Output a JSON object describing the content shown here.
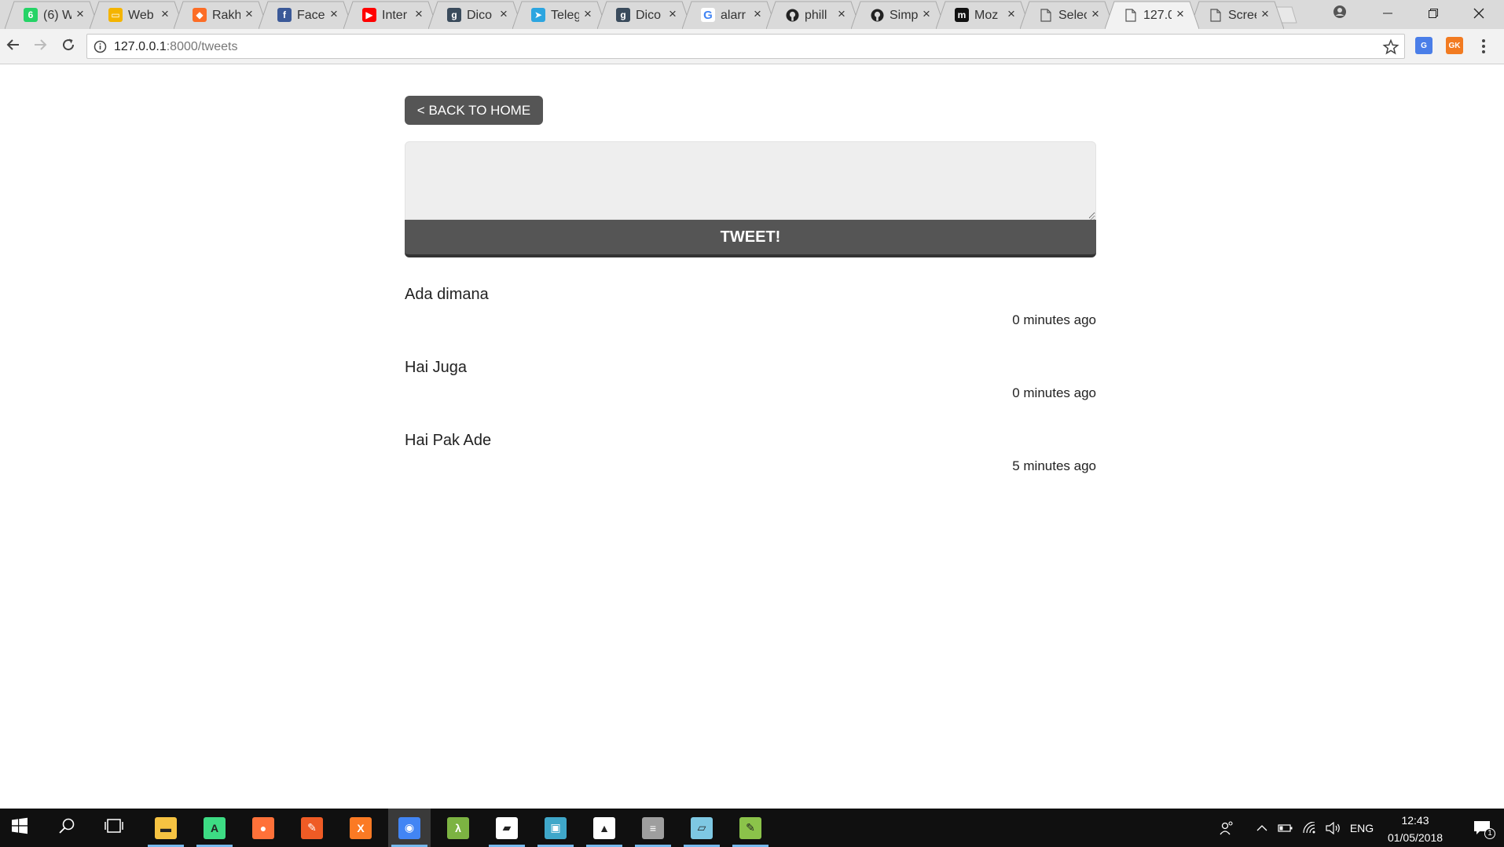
{
  "browser": {
    "tabs": [
      {
        "title": "(6) W",
        "favicon": "whatsapp-icon",
        "color": "#25d366",
        "glyph": "6"
      },
      {
        "title": "Web",
        "favicon": "slides-icon",
        "color": "#f4b400",
        "glyph": "▭"
      },
      {
        "title": "Rakh",
        "favicon": "gitlab-icon",
        "color": "#fc6d26",
        "glyph": "◆"
      },
      {
        "title": "Face",
        "favicon": "facebook-icon",
        "color": "#3b5998",
        "glyph": "f"
      },
      {
        "title": "Inter",
        "favicon": "youtube-icon",
        "color": "#ff0000",
        "glyph": "▶"
      },
      {
        "title": "Dico",
        "favicon": "goodreads-icon",
        "color": "#3a4b5c",
        "glyph": "g"
      },
      {
        "title": "Teleg",
        "favicon": "telegram-icon",
        "color": "#2ca5e0",
        "glyph": "➤"
      },
      {
        "title": "Dico",
        "favicon": "goodreads-icon",
        "color": "#3a4b5c",
        "glyph": "g"
      },
      {
        "title": "alarr",
        "favicon": "google-icon",
        "color": "#ffffff",
        "glyph": "G"
      },
      {
        "title": "phill",
        "favicon": "github-icon",
        "color": "#222222",
        "glyph": "●"
      },
      {
        "title": "Simp",
        "favicon": "github-icon",
        "color": "#222222",
        "glyph": "●"
      },
      {
        "title": "Moz",
        "favicon": "medium-icon",
        "color": "#111111",
        "glyph": "m"
      },
      {
        "title": "Selec",
        "favicon": "page-icon",
        "color": "#dadada",
        "glyph": ""
      },
      {
        "title": "127.0",
        "favicon": "page-icon",
        "color": "#f2f2f2",
        "glyph": "",
        "active": true
      },
      {
        "title": "Scree",
        "favicon": "page-icon",
        "color": "#dadada",
        "glyph": ""
      }
    ],
    "close_glyph": "×",
    "url_host": "127.0.0.1",
    "url_rest": ":8000/tweets"
  },
  "page": {
    "back_label": "< BACK TO HOME",
    "tweet_placeholder": "",
    "tweet_button": "TWEET!",
    "tweets": [
      {
        "text": "Ada dimana",
        "time": "0 minutes ago"
      },
      {
        "text": "Hai Juga",
        "time": "0 minutes ago"
      },
      {
        "text": "Hai Pak Ade",
        "time": "5 minutes ago"
      }
    ]
  },
  "taskbar": {
    "language": "ENG",
    "time": "12:43",
    "date": "01/05/2018",
    "notification_count": "1",
    "apps": [
      {
        "name": "file-explorer-icon",
        "color": "#f6c342",
        "glyph": "▬",
        "running": true
      },
      {
        "name": "android-studio-icon",
        "color": "#3ddc84",
        "glyph": "A",
        "running": true
      },
      {
        "name": "firefox-icon",
        "color": "#ff7139",
        "glyph": "●",
        "running": false
      },
      {
        "name": "postman-icon",
        "color": "#ef5b25",
        "glyph": "✎",
        "running": false
      },
      {
        "name": "xampp-icon",
        "color": "#fb7a24",
        "glyph": "X",
        "running": false
      },
      {
        "name": "chrome-icon",
        "color": "#4285f4",
        "glyph": "◉",
        "running": true,
        "active": true
      },
      {
        "name": "lambda-app-icon",
        "color": "#7cb342",
        "glyph": "λ",
        "running": false
      },
      {
        "name": "sticky-notes-icon",
        "color": "#ffffff",
        "glyph": "▰",
        "running": true
      },
      {
        "name": "window-app-icon",
        "color": "#3fa7c9",
        "glyph": "▣",
        "running": true
      },
      {
        "name": "photos-icon",
        "color": "#ffffff",
        "glyph": "▲",
        "running": true
      },
      {
        "name": "database-icon",
        "color": "#9e9e9e",
        "glyph": "≡",
        "running": true
      },
      {
        "name": "editor-icon",
        "color": "#7ec8e3",
        "glyph": "▱",
        "running": true
      },
      {
        "name": "notepad-icon",
        "color": "#8bc34a",
        "glyph": "✎",
        "running": true
      }
    ]
  },
  "colors": {
    "button_bg": "#555555",
    "textarea_bg": "#eeeeee",
    "taskbar_bg": "#101010",
    "tab_strip_bg": "#dadada"
  }
}
